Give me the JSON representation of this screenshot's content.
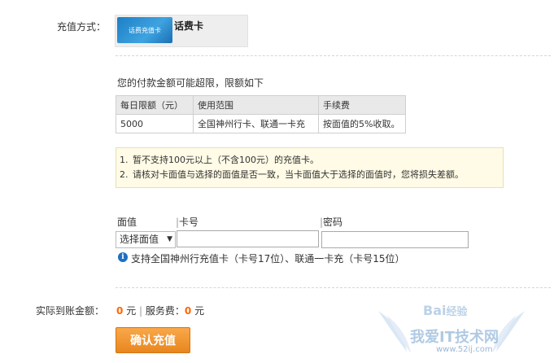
{
  "payment": {
    "label": "充值方式：",
    "card_image_text": "话费充值卡",
    "card_name": "话费卡"
  },
  "limits": {
    "intro": "您的付款金额可能超限，限额如下",
    "headers": [
      "每日限额（元）",
      "使用范围",
      "手续费"
    ],
    "row": [
      "5000",
      "全国神州行卡、联通一卡充",
      "按面值的5%收取。"
    ]
  },
  "notice": {
    "items": [
      {
        "num": "1.",
        "text": "暂不支持100元以上（不含100元）的充值卡。"
      },
      {
        "num": "2.",
        "text": "请核对卡面值与选择的面值是否一致，当卡面值大于选择的面值时，您将损失差额。"
      }
    ]
  },
  "form": {
    "denomination_label": "面值",
    "card_number_label": "卡号",
    "password_label": "密码",
    "select_value": "选择面值",
    "support_text": "支持全国神州行充值卡（卡号17位）、联通一卡充（卡号15位）"
  },
  "summary": {
    "label": "实际到账金额：",
    "amount": "0",
    "unit": "元",
    "fee_label": "服务费：",
    "fee": "0",
    "fee_unit": "元"
  },
  "confirm_button": "确认充值",
  "watermark": {
    "logo": "Bai",
    "logo_suffix": "经验",
    "brand": "我爱IT技术网",
    "url": "www.52ij.com"
  }
}
